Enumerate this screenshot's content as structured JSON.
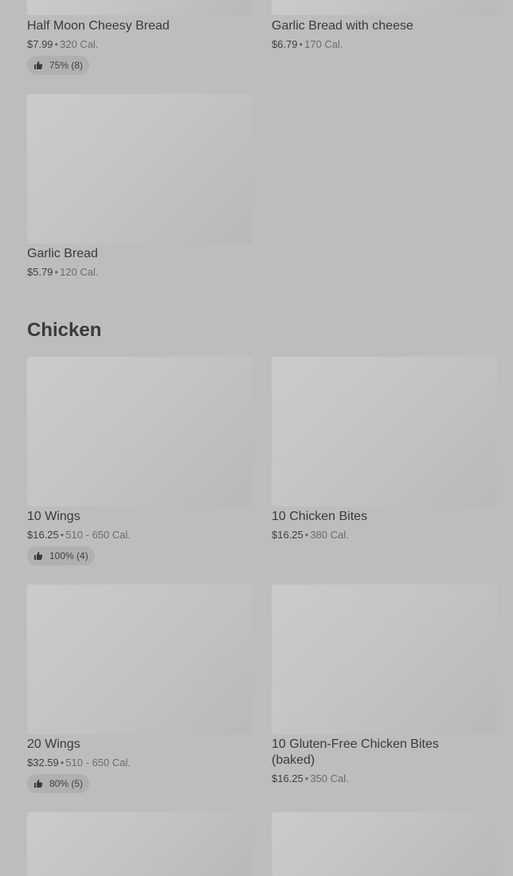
{
  "sections": {
    "chicken_title": "Chicken"
  },
  "items": {
    "half_moon": {
      "name": "Half Moon Cheesy Bread",
      "price": "$7.99",
      "calories": "320 Cal.",
      "rating": "75% (8)"
    },
    "garlic_cheese": {
      "name": "Garlic Bread with cheese",
      "price": "$6.79",
      "calories": "170 Cal."
    },
    "garlic_bread": {
      "name": "Garlic Bread",
      "price": "$5.79",
      "calories": "120 Cal."
    },
    "wings10": {
      "name": "10 Wings",
      "price": "$16.25",
      "calories": "510 - 650 Cal.",
      "rating": "100% (4)"
    },
    "bites10": {
      "name": "10 Chicken Bites",
      "price": "$16.25",
      "calories": "380 Cal."
    },
    "wings20": {
      "name": "20 Wings",
      "price": "$32.59",
      "calories": "510 - 650 Cal.",
      "rating": "80% (5)"
    },
    "gf_bites": {
      "name": "10 Gluten-Free Chicken Bites (baked)",
      "price": "$16.25",
      "calories": "350 Cal."
    }
  },
  "icons": {
    "rating": "thumbs-up-icon"
  },
  "colors": {
    "background": "#bdbdbd",
    "image_placeholder": "#c4c4c4",
    "badge": "#b0b0b0"
  }
}
